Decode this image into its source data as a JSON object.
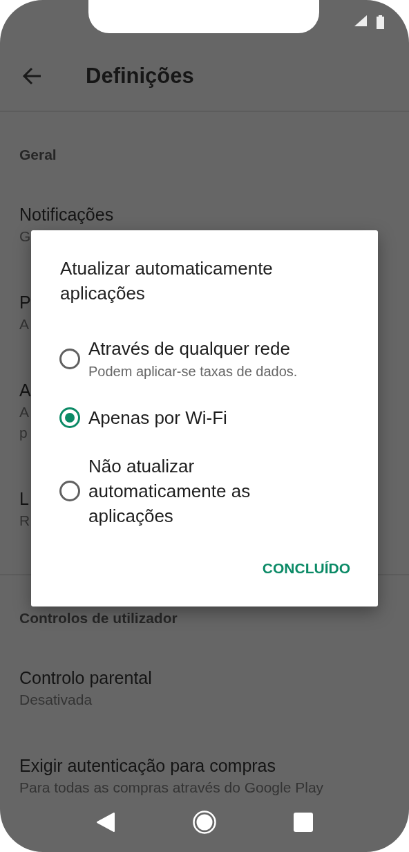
{
  "toolbar": {
    "title": "Definições"
  },
  "sections": [
    {
      "header": "Geral",
      "items": [
        {
          "title": "Notificações",
          "subtitle_lines": [
            "G"
          ]
        },
        {
          "title": "P",
          "subtitle_lines": [
            "A"
          ]
        },
        {
          "title": "A",
          "subtitle_lines": [
            "A",
            "p"
          ]
        },
        {
          "title": "L",
          "subtitle_lines": [
            "R"
          ]
        }
      ]
    },
    {
      "header": "Controlos de utilizador",
      "items": [
        {
          "title": "Controlo parental",
          "subtitle_lines": [
            "Desativada"
          ]
        },
        {
          "title": "Exigir autenticação para compras",
          "subtitle_lines": [
            "Para todas as compras através do Google Play"
          ]
        }
      ]
    }
  ],
  "dialog": {
    "title": "Atualizar automaticamente aplicações",
    "options": [
      {
        "label": "Através de qualquer rede",
        "sublabel": "Podem aplicar-se taxas de dados.",
        "selected": false
      },
      {
        "label": "Apenas por Wi-Fi",
        "selected": true
      },
      {
        "label": "Não atualizar automaticamente as aplicações",
        "selected": false
      }
    ],
    "button": "CONCLUÍDO"
  }
}
